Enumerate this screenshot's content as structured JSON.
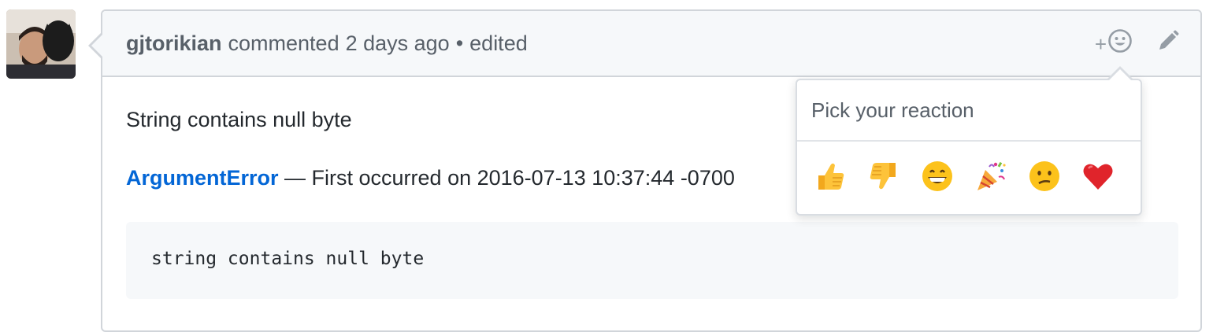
{
  "comment": {
    "author": "gjtorikian",
    "action": "commented",
    "time": "2 days ago",
    "separator": "•",
    "edited": "edited",
    "add_reaction_label": "+",
    "body": {
      "line1": "String contains null byte",
      "error_link": "ArgumentError",
      "error_suffix": " — First occurred on 2016-07-13 10:37:44 -0700",
      "code": "string contains null byte"
    }
  },
  "reactions": {
    "title": "Pick your reaction",
    "items": [
      {
        "name": "thumbs-up",
        "glyph": "👍"
      },
      {
        "name": "thumbs-down",
        "glyph": "👎"
      },
      {
        "name": "laugh",
        "glyph": "😄"
      },
      {
        "name": "hooray",
        "glyph": "🎉"
      },
      {
        "name": "confused",
        "glyph": "😕"
      },
      {
        "name": "heart",
        "glyph": "❤️"
      }
    ]
  },
  "colors": {
    "link": "#0366d6",
    "header_bg": "#f6f8fa",
    "border": "#d1d5da",
    "muted": "#586069"
  }
}
